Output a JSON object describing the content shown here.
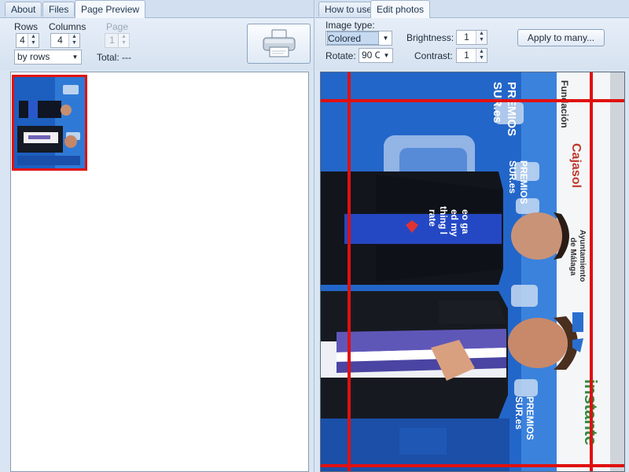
{
  "left_tabs": [
    "About",
    "Files",
    "Page Preview"
  ],
  "right_tabs": [
    "How to use",
    "Edit photos"
  ],
  "layout": {
    "rows_label": "Rows",
    "rows_value": "4",
    "columns_label": "Columns",
    "columns_value": "4",
    "order_value": "by rows",
    "page_label": "Page",
    "page_value": "1",
    "total_label": "Total: ---"
  },
  "edit": {
    "image_type_label": "Image type:",
    "image_type_value": "Colored",
    "rotate_label": "Rotate:",
    "rotate_value": "90 C",
    "brightness_label": "Brightness:",
    "brightness_value": "1",
    "contrast_label": "Contrast:",
    "contrast_value": "1",
    "apply_button": "Apply to many..."
  },
  "photo_text": {
    "fundacion": "Fundación",
    "cajasol": "Cajasol",
    "premios": "PREMIOS",
    "sur": "SUR.es",
    "ayuntamiento": "Ayuntamiento",
    "de_malaga": "de Málaga",
    "instante": "instante",
    "shirt_1": "eo ga",
    "shirt_2": "ed my",
    "shirt_3": "thing l",
    "shirt_4": "rate",
    "sur_small_1": "PREMIOS",
    "sur_small_2": "SUR.es"
  },
  "colors": {
    "selection_red": "#e01010",
    "accent_blue": "#2a6fd0",
    "banner_blue": "#1e64c8"
  },
  "icons": {
    "print": "printer-icon"
  }
}
